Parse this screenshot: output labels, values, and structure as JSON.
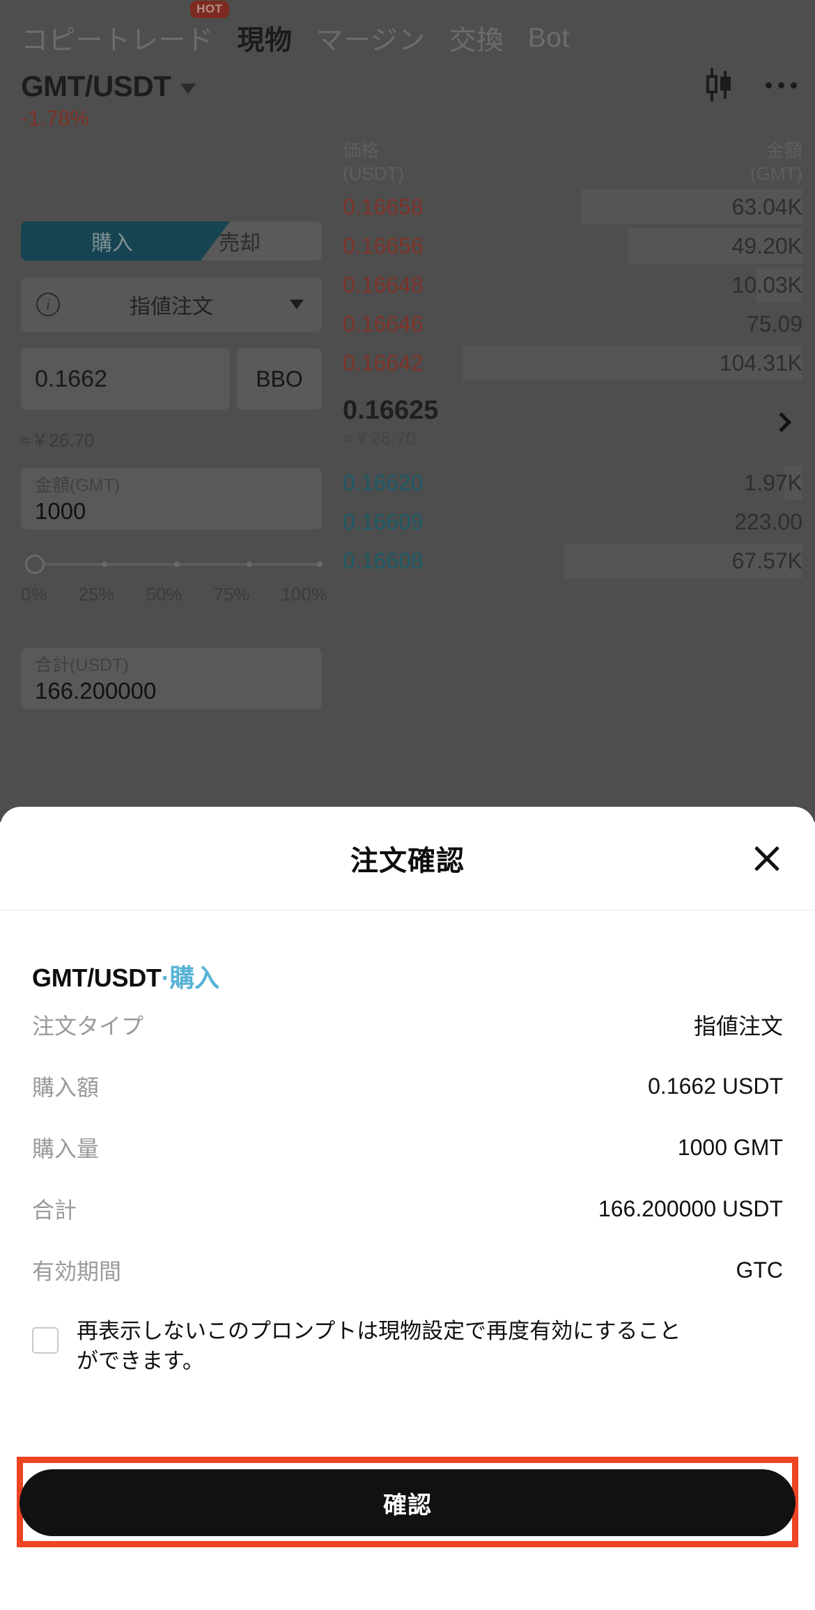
{
  "nav": {
    "tabs": [
      {
        "label": "コピートレード",
        "badge": "HOT",
        "active": false
      },
      {
        "label": "現物",
        "badge": "",
        "active": true
      },
      {
        "label": "マージン",
        "badge": "",
        "active": false
      },
      {
        "label": "交換",
        "badge": "",
        "active": false
      },
      {
        "label": "Bot",
        "badge": "",
        "active": false
      }
    ]
  },
  "market": {
    "pair": "GMT/USDT",
    "change_pct": "-1.78%",
    "change_color": "#7e3026"
  },
  "order_form": {
    "buy_label": "購入",
    "sell_label": "売却",
    "order_type": "指値注文",
    "price_value": "0.1662",
    "bbo_label": "BBO",
    "price_approx": "≈￥26.70",
    "amount_label": "金額(GMT)",
    "amount_value": "1000",
    "slider_labels": [
      "0%",
      "25%",
      "50%",
      "75%",
      "100%"
    ],
    "total_label": "合計(USDT)",
    "total_value": "166.200000"
  },
  "orderbook": {
    "col_price": "価格",
    "col_price_unit": "(USDT)",
    "col_amount": "金額",
    "col_amount_unit": "(GMT)",
    "asks": [
      {
        "price": "0.16658",
        "amount": "63.04K",
        "depth": 48
      },
      {
        "price": "0.16656",
        "amount": "49.20K",
        "depth": 38
      },
      {
        "price": "0.16648",
        "amount": "10.03K",
        "depth": 10
      },
      {
        "price": "0.16646",
        "amount": "75.09",
        "depth": 0
      },
      {
        "price": "0.16642",
        "amount": "104.31K",
        "depth": 74
      }
    ],
    "last_price": "0.16625",
    "last_price_fiat": "≈￥26.70",
    "bids": [
      {
        "price": "0.16620",
        "amount": "1.97K",
        "depth": 4
      },
      {
        "price": "0.16609",
        "amount": "223.00",
        "depth": 0
      },
      {
        "price": "0.16608",
        "amount": "67.57K",
        "depth": 52
      }
    ]
  },
  "modal": {
    "title": "注文確認",
    "close_icon": "close-icon",
    "pair": "GMT/USDT",
    "separator": "·",
    "side": "購入",
    "rows": [
      {
        "key": "注文タイプ",
        "value": "指値注文"
      },
      {
        "key": "購入額",
        "value": "0.1662 USDT"
      },
      {
        "key": "購入量",
        "value": "1000 GMT"
      },
      {
        "key": "合計",
        "value": "166.200000 USDT"
      },
      {
        "key": "有効期間",
        "value": "GTC"
      }
    ],
    "checkbox_label": "再表示しないこのプロンプトは現物設定で再度有効にすることができます。",
    "checkbox_checked": false,
    "confirm_label": "確認",
    "highlight_color": "#ef4423",
    "accent_color": "#56b2d4"
  }
}
